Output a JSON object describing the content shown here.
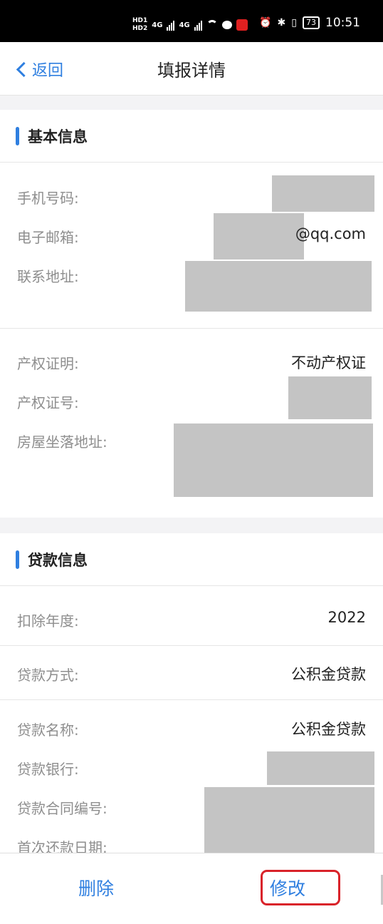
{
  "status_bar": {
    "hd1": "HD1",
    "hd2": "HD2",
    "net1": "4G",
    "net2": "4G",
    "battery": "73",
    "time": "10:51"
  },
  "nav": {
    "back_label": "返回",
    "title": "填报详情"
  },
  "basic_info": {
    "title": "基本信息",
    "phone_label": "手机号码:",
    "email_label": "电子邮箱:",
    "email_suffix": "@qq.com",
    "address_label": "联系地址:",
    "property_cert_label": "产权证明:",
    "property_cert_value": "不动产权证",
    "property_cert_no_label": "产权证号:",
    "house_address_label": "房屋坐落地址:"
  },
  "loan_info": {
    "title": "贷款信息",
    "year_label": "扣除年度:",
    "year_value": "2022",
    "method_label": "贷款方式:",
    "method_value": "公积金贷款",
    "name_label": "贷款名称:",
    "name_value": "公积金贷款",
    "bank_label": "贷款银行:",
    "contract_label": "贷款合同编号:",
    "first_repay_label": "首次还款日期:"
  },
  "actions": {
    "delete_label": "删除",
    "edit_label": "修改"
  },
  "colors": {
    "accent": "#2f7fe0",
    "highlight": "#d9232a",
    "redaction": "#c4c4c4"
  }
}
